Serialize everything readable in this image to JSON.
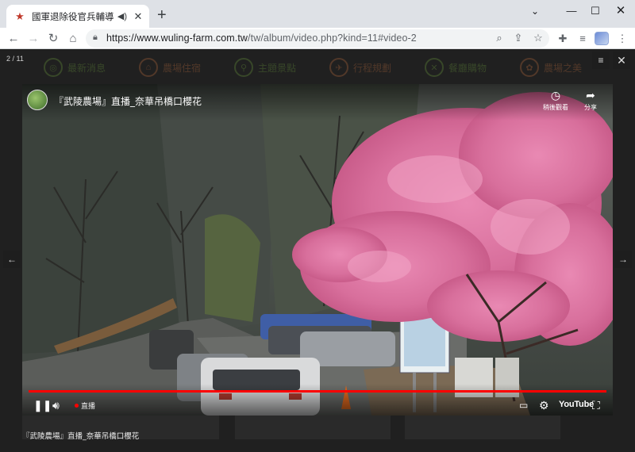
{
  "browser": {
    "tab_title": "國軍退除役官兵輔導委員會武",
    "new_tab": "+",
    "url_domain": "https://www.wuling-farm.com.tw",
    "url_path": "/tw/album/video.php?kind=11#video-2"
  },
  "site_nav": {
    "items": [
      {
        "label": "最新消息"
      },
      {
        "label": "農場住宿"
      },
      {
        "label": "主題景點"
      },
      {
        "label": "行程規劃"
      },
      {
        "label": "餐廳購物"
      },
      {
        "label": "農場之美"
      }
    ]
  },
  "lightbox": {
    "counter": "2 / 11",
    "caption": "『武陵農場』直播_奈華吊橋口櫻花"
  },
  "video": {
    "title": "『武陵農場』直播_奈華吊橋口櫻花",
    "watch_later": "稍後觀看",
    "share": "分享",
    "live_label": "直播",
    "youtube": "YouTube",
    "progress": 1.0
  },
  "colors": {
    "progress": "#ff0000",
    "blossom": "#e07aa8"
  }
}
